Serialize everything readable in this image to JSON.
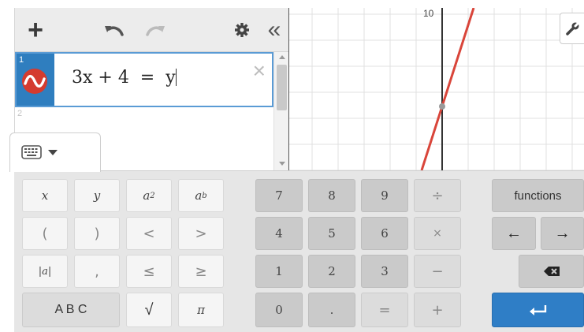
{
  "expression_panel": {
    "add_label": "+",
    "collapse_label": "«",
    "expressions": [
      {
        "index": "1",
        "latex_display": "3x + 4  =  y"
      },
      {
        "index": "2",
        "latex_display": ""
      }
    ],
    "delete_label": "×"
  },
  "graph": {
    "y_tick_label": "10",
    "line_color": "#d9453a",
    "point_color": "#9a9a9a"
  },
  "keypad": {
    "math_keys": {
      "x": "x",
      "y": "y",
      "a": "a",
      "sq": "2",
      "pow": "b",
      "lparen": "(",
      "rparen": ")",
      "lt": "<",
      "gt": ">",
      "abs": "|a|",
      "comma": ",",
      "le": "≤",
      "ge": "≥",
      "abc": "A B C",
      "sqrt": "√",
      "pi": "π"
    },
    "num_keys": {
      "7": "7",
      "8": "8",
      "9": "9",
      "div": "÷",
      "4": "4",
      "5": "5",
      "6": "6",
      "mul": "×",
      "1": "1",
      "2": "2",
      "3": "3",
      "minus": "−",
      "0": "0",
      "dot": ".",
      "eq": "=",
      "plus": "+"
    },
    "functions_label": "functions",
    "left_arrow": "←",
    "right_arrow": "→"
  },
  "colors": {
    "accent_blue": "#2f7ec6",
    "graph_line_red": "#d9453a"
  }
}
